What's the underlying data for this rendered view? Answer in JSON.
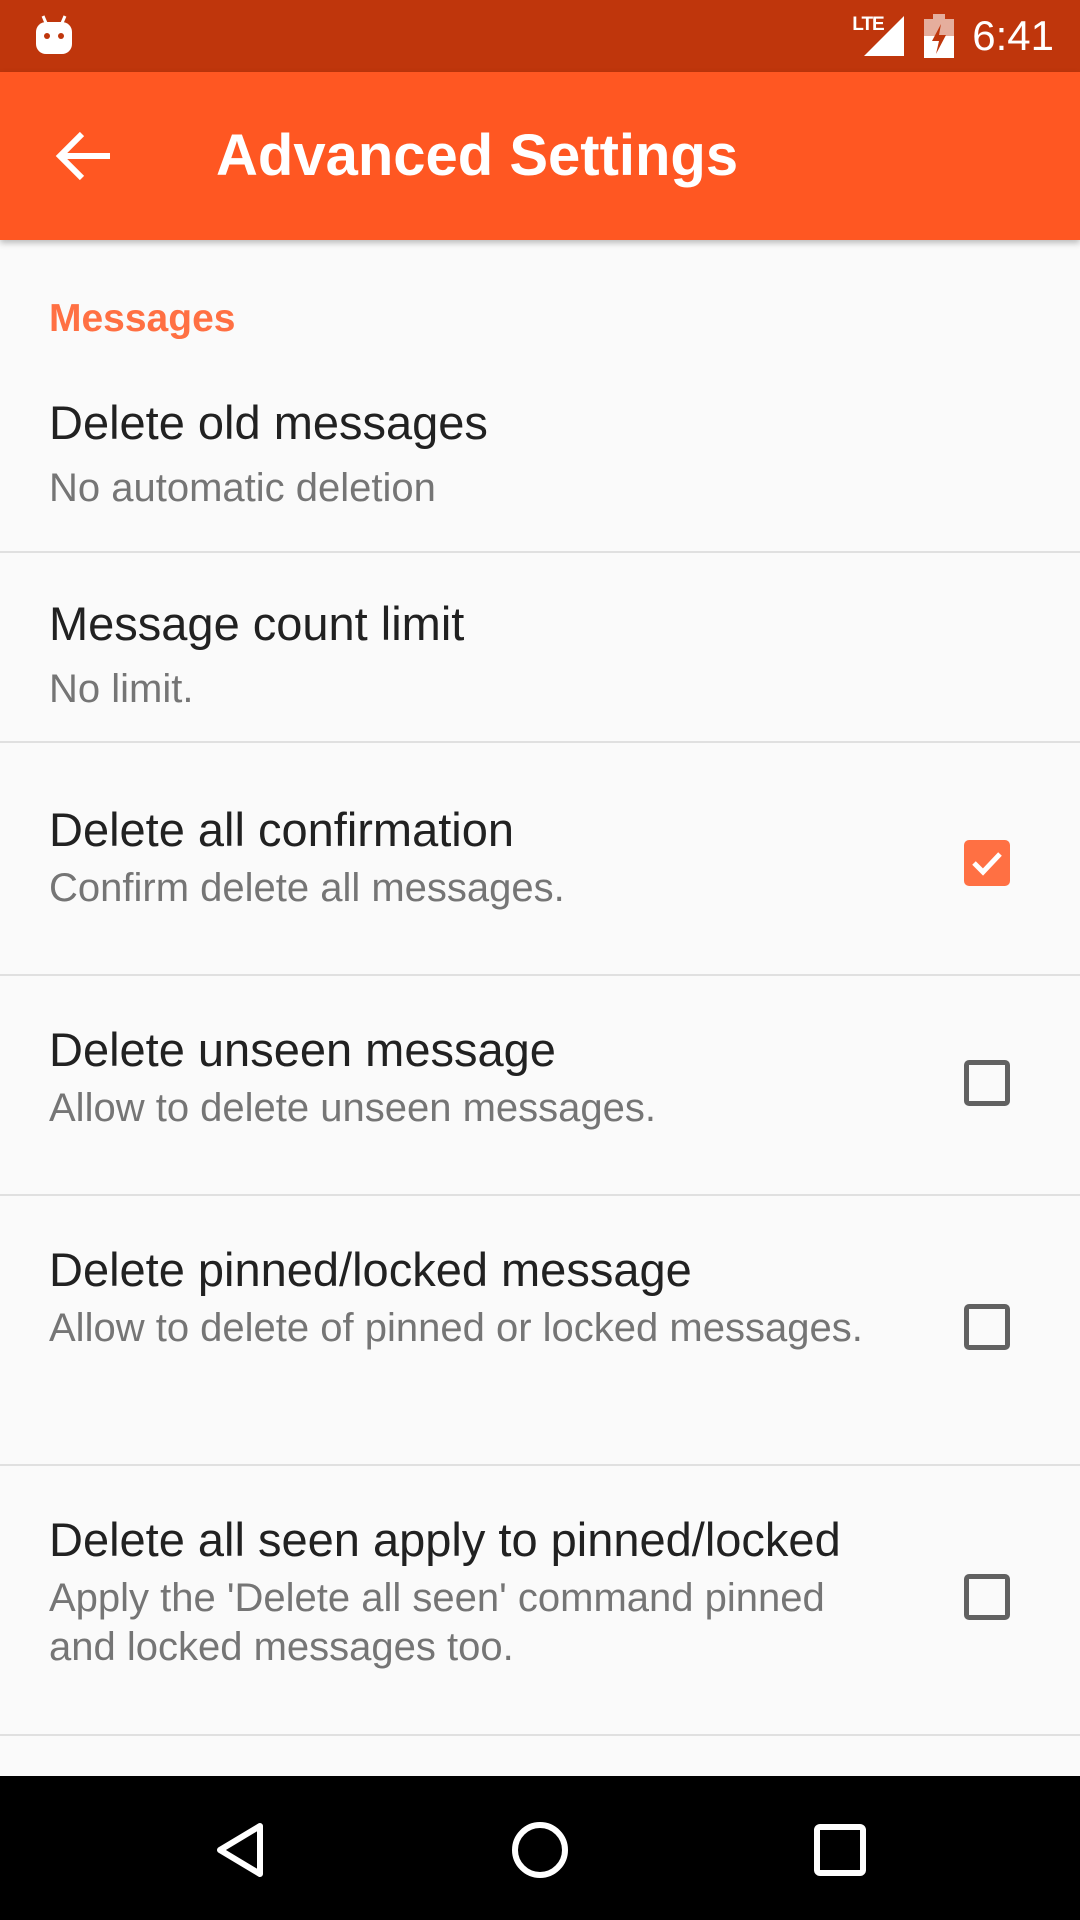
{
  "status_bar": {
    "network": "LTE",
    "time": "6:41"
  },
  "toolbar": {
    "title": "Advanced Settings"
  },
  "section": {
    "title": "Messages"
  },
  "preferences": [
    {
      "title": "Delete old messages",
      "summary": "No automatic deletion"
    },
    {
      "title": "Message count limit",
      "summary": "No limit."
    },
    {
      "title": "Delete all confirmation",
      "summary": "Confirm delete all messages.",
      "checked": true
    },
    {
      "title": "Delete unseen message",
      "summary": "Allow to delete unseen messages.",
      "checked": false
    },
    {
      "title": "Delete pinned/locked message",
      "summary": "Allow to delete of pinned or locked messages.",
      "checked": false
    },
    {
      "title": "Delete all seen apply to pinned/locked",
      "summary": "Apply the 'Delete all seen' command pinned and locked messages too.",
      "checked": false
    }
  ],
  "colors": {
    "status_bar": "#bf360c",
    "toolbar": "#ff5722",
    "accent": "#ff7043",
    "nav_bar": "#000000"
  },
  "icons": {
    "status_left": "android-notification-icon",
    "signal": "signal-icon",
    "battery": "battery-charging-icon",
    "back": "arrow-back-icon",
    "nav_back": "nav-back-icon",
    "nav_home": "nav-home-icon",
    "nav_recents": "nav-recents-icon"
  }
}
